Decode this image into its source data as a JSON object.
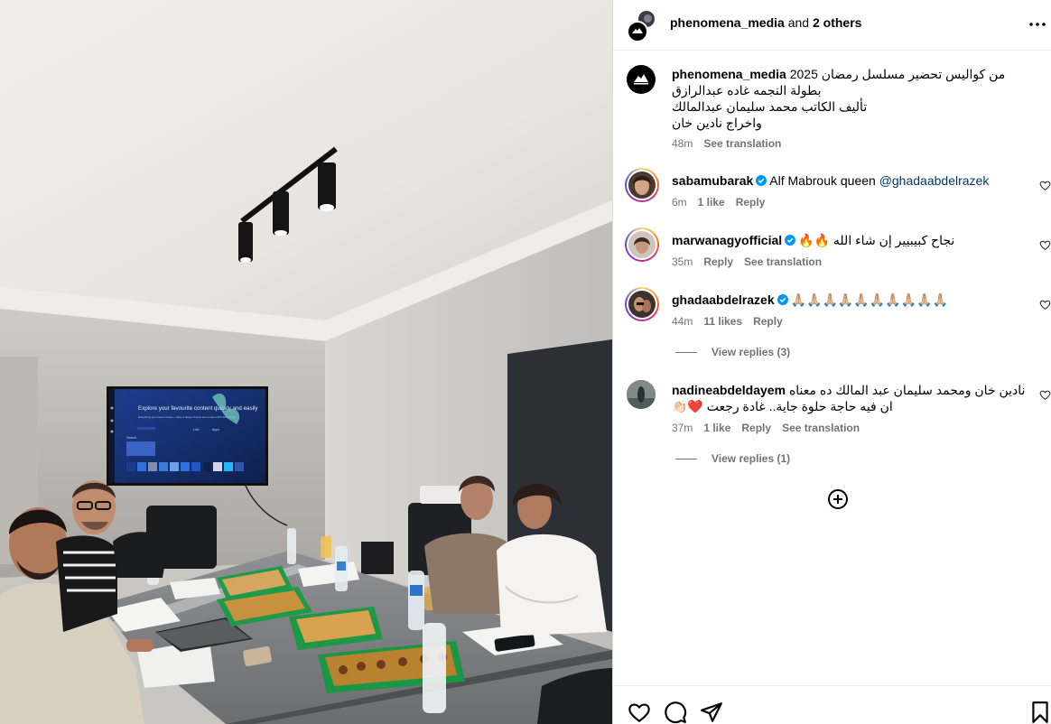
{
  "header": {
    "author": "phenomena_media",
    "joiner": " and ",
    "others": "2 others"
  },
  "caption": {
    "author": "phenomena_media",
    "lines": [
      "من كواليس تحضير مسلسل رمضان 2025",
      "بطولة النجمه غاده عبدالرازق",
      "تأليف الكاتب محمد سليمان عبدالمالك",
      "واخراج نادين خان"
    ],
    "time": "48m",
    "see_translation": "See translation"
  },
  "comments": [
    {
      "user": "sabamubarak",
      "verified": true,
      "text": "Alf Mabrouk queen ",
      "mention": "@ghadaabdelrazek",
      "time": "6m",
      "likes": "1 like",
      "reply": "Reply"
    },
    {
      "user": "marwanagyofficial",
      "verified": true,
      "text": "نجاح كبيبيير إن شاء الله 🔥🔥",
      "time": "35m",
      "reply": "Reply",
      "see_translation": "See translation"
    },
    {
      "user": "ghadaabdelrazek",
      "verified": true,
      "text": "🙏🏼🙏🏼🙏🏼🙏🏼🙏🏼🙏🏼🙏🏼🙏🏼🙏🏼🙏🏼",
      "time": "44m",
      "likes": "11 likes",
      "reply": "Reply",
      "view_replies": "View replies (3)"
    },
    {
      "user": "nadineabdeldayem",
      "verified": false,
      "text_line1": "نادين خان ومحمد سليمان عبد المالك ده معناه",
      "text_line2": "ان فيه حاجة حلوة جاية.. غادة رجعت ❤️👏🏻",
      "time": "37m",
      "likes": "1 like",
      "reply": "Reply",
      "see_translation": "See translation",
      "view_replies": "View replies (1)"
    }
  ],
  "photo": {
    "tv_headline": "Explore your favourite content quickly and easily",
    "tv_subline": "Everything you need in focus - enjoy a range of apps and content with Smart Hub",
    "tv_tabs": [
      "Search",
      "Live",
      "Apps"
    ]
  },
  "icons": {
    "more": "more-horizontal-icon",
    "like": "heart-icon",
    "comment": "comment-icon",
    "share": "share-icon",
    "save": "bookmark-icon",
    "add": "add-comment-icon",
    "verified": "verified-badge-icon"
  },
  "colors": {
    "verified": "#0095f6",
    "mention": "#00376b",
    "secondary_text": "#737373",
    "divider": "#dbdbdb"
  }
}
